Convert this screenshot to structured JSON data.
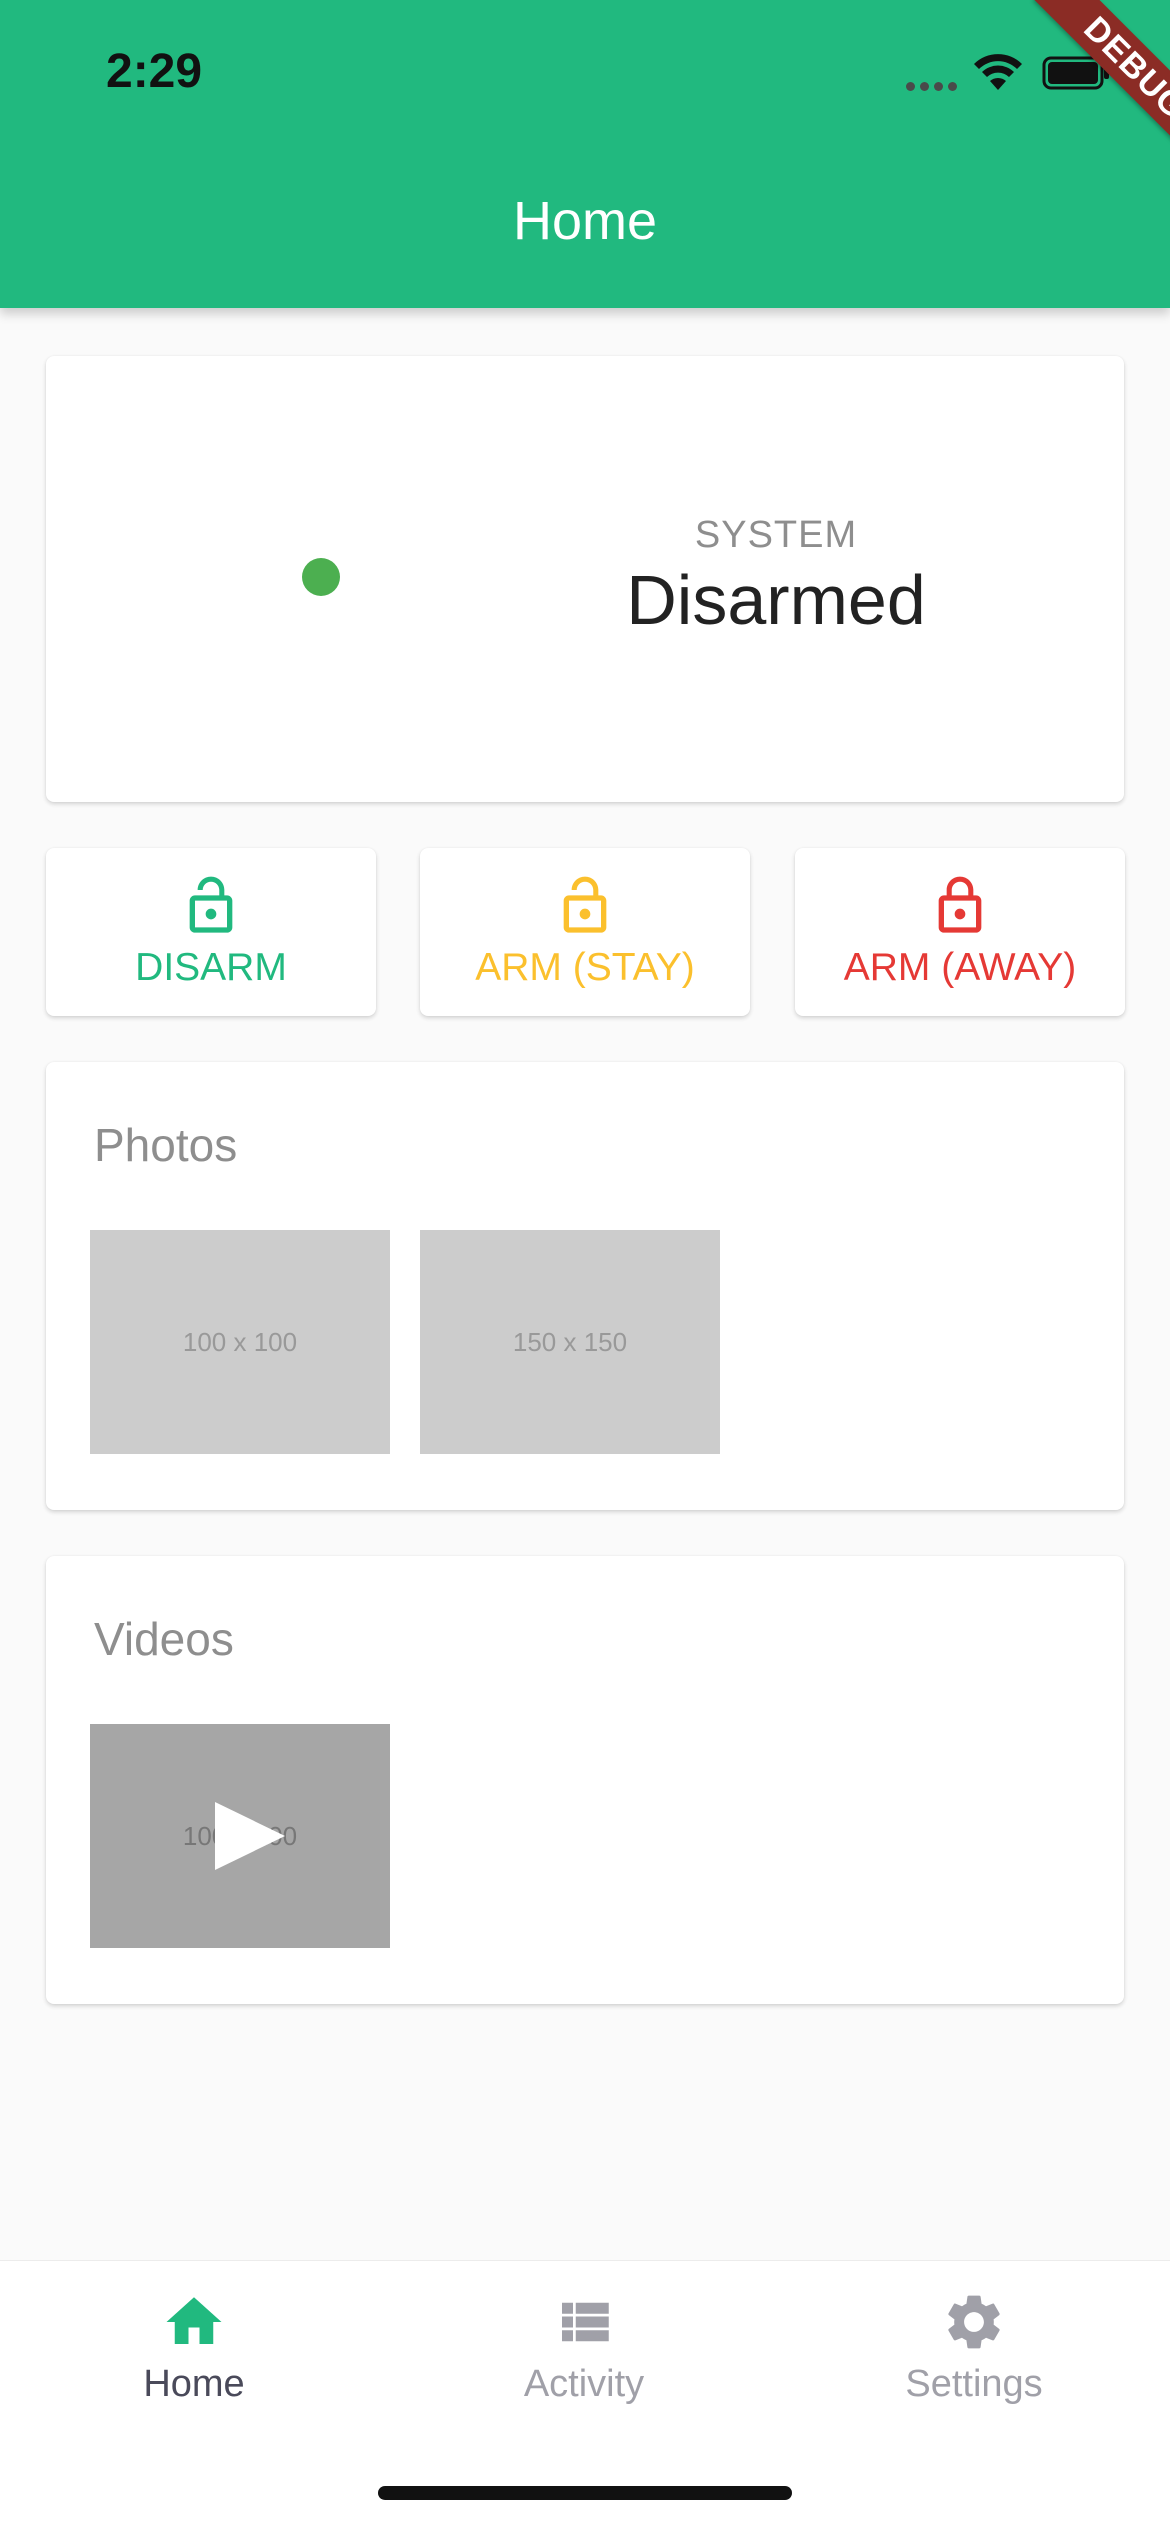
{
  "status_bar": {
    "time": "2:29"
  },
  "app_bar": {
    "title": "Home",
    "debug_banner": "DEBUG"
  },
  "system": {
    "label": "SYSTEM",
    "value": "Disarmed",
    "indicator_color": "#4caf50"
  },
  "actions": [
    {
      "label": "DISARM",
      "icon": "lock-open-icon",
      "color": "#21b97f"
    },
    {
      "label": "ARM (STAY)",
      "icon": "lock-open-icon",
      "color": "#fbc02d"
    },
    {
      "label": "ARM (AWAY)",
      "icon": "lock-icon",
      "color": "#e53935"
    }
  ],
  "photos": {
    "title": "Photos",
    "items": [
      {
        "placeholder": "100 x 100"
      },
      {
        "placeholder": "150 x 150"
      }
    ]
  },
  "videos": {
    "title": "Videos",
    "items": [
      {
        "placeholder": "100 x 100",
        "icon": "play-icon"
      }
    ]
  },
  "bottom_nav": {
    "active_color": "#21b97f",
    "items": [
      {
        "label": "Home",
        "icon": "home-icon",
        "active": true
      },
      {
        "label": "Activity",
        "icon": "list-icon",
        "active": false
      },
      {
        "label": "Settings",
        "icon": "gear-icon",
        "active": false
      }
    ]
  },
  "colors": {
    "primary": "#21b97f",
    "background": "#fafafa"
  }
}
